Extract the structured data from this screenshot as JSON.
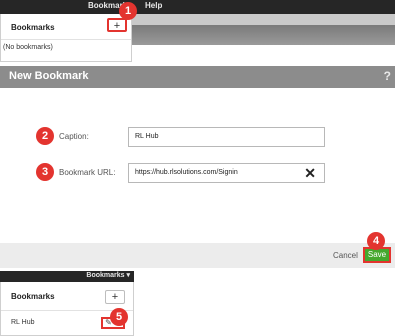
{
  "top_panel": {
    "menu_bookmarks": "Bookmarks",
    "menu_help": "Help",
    "dropdown_header": "Bookmarks",
    "add_label": "+",
    "empty_text": "(No bookmarks)"
  },
  "dialog": {
    "title": "New Bookmark",
    "help": "?",
    "caption_label": "Caption:",
    "caption_value": "RL Hub",
    "url_label": "Bookmark URL:",
    "url_value": "https://hub.rlsolutions.com/Signin",
    "clear_glyph": "✕",
    "cancel_label": "Cancel",
    "save_label": "Save"
  },
  "bottom_panel": {
    "menu_bookmarks": "Bookmarks ▾",
    "dropdown_header": "Bookmarks",
    "add_label": "+",
    "item_label": "RL Hub",
    "item_actions": "✎ ✖"
  },
  "badges": [
    "1",
    "2",
    "3",
    "4",
    "5"
  ],
  "colors": {
    "badge": "#e3342f",
    "save_button": "#45a82e",
    "dialog_header": "#8c8c8c",
    "top_bar": "#262626"
  }
}
